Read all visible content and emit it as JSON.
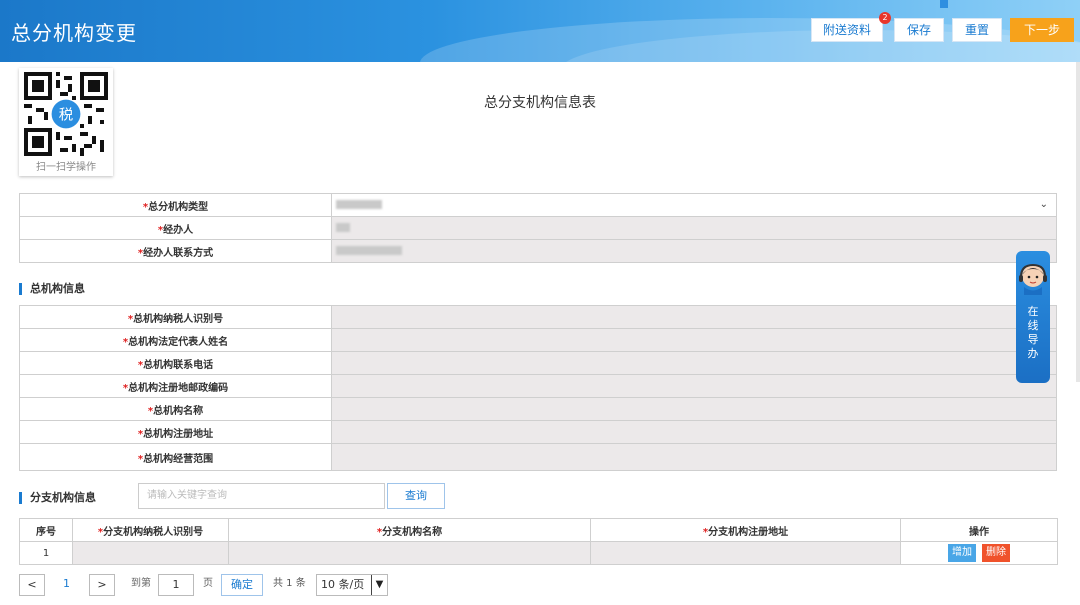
{
  "header": {
    "title": "总分机构变更",
    "attach_label": "附送资料",
    "attach_badge": "2",
    "save_label": "保存",
    "reset_label": "重置",
    "next_label": "下一步"
  },
  "qr": {
    "caption": "扫一扫学操作",
    "logo_text": "税"
  },
  "form_title": "总分支机构信息表",
  "basic": [
    {
      "label": "总分机构类型",
      "required": "*"
    },
    {
      "label": "经办人",
      "required": "*"
    },
    {
      "label": "经办人联系方式",
      "required": "*"
    }
  ],
  "head_section": {
    "title": "总机构信息"
  },
  "head": [
    {
      "label": "总机构纳税人识别号",
      "required": "*"
    },
    {
      "label": "总机构法定代表人姓名",
      "required": "*"
    },
    {
      "label": "总机构联系电话",
      "required": "*"
    },
    {
      "label": "总机构注册地邮政编码",
      "required": "*"
    },
    {
      "label": "总机构名称",
      "required": "*"
    },
    {
      "label": "总机构注册地址",
      "required": "*"
    },
    {
      "label": "总机构经营范围",
      "required": "*"
    }
  ],
  "branch_section": {
    "title": "分支机构信息",
    "search_placeholder": "请输入关键字查询",
    "search_label": "查询"
  },
  "branch_table": {
    "columns": [
      "序号",
      "分支机构纳税人识别号",
      "分支机构名称",
      "分支机构注册地址",
      "操作"
    ],
    "required": "*",
    "rows": [
      {
        "index": "1",
        "add_label": "增加",
        "delete_label": "删除"
      }
    ]
  },
  "pagination": {
    "prev": "<",
    "current": "1",
    "next": ">",
    "goto_label": "到第",
    "goto_value": "1",
    "page_unit": "页",
    "ok_label": "确定",
    "total": "共 1 条",
    "page_size": "10 条/页"
  },
  "guide": {
    "text": "在线导办"
  },
  "colors": {
    "primary": "#1a7bd0",
    "next": "#f7a21b",
    "required": "#e02020",
    "delete": "#f0522b",
    "add": "#49a6e7"
  }
}
